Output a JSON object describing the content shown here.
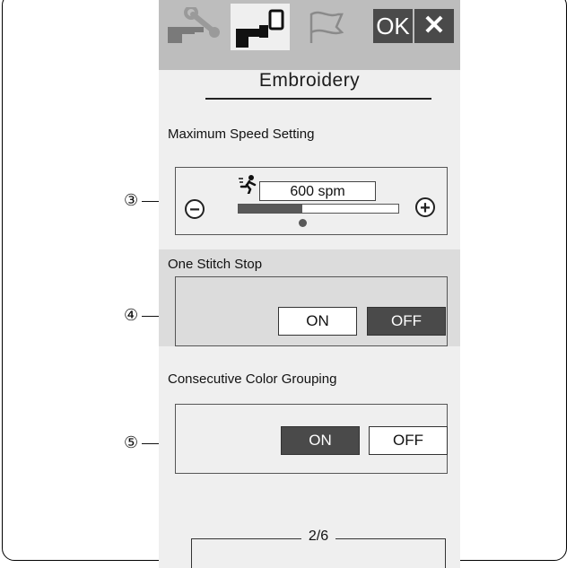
{
  "header": {
    "tabs": [
      {
        "name": "settings-tab",
        "icon": "wrench-machine-icon"
      },
      {
        "name": "embroidery-tab",
        "icon": "embroidery-machine-icon"
      },
      {
        "name": "language-tab",
        "icon": "flag-icon"
      }
    ],
    "ok_label": "OK",
    "close_label": "✕"
  },
  "page_title": "Embroidery",
  "max_speed": {
    "label": "Maximum Speed Setting",
    "value_text": "600 spm",
    "minus_label": "−",
    "plus_label": "+",
    "level_fraction": 0.4
  },
  "one_stitch_stop": {
    "label": "One Stitch Stop",
    "on_label": "ON",
    "off_label": "OFF",
    "selected": "OFF"
  },
  "color_grouping": {
    "label": "Consecutive Color Grouping",
    "on_label": "ON",
    "off_label": "OFF",
    "selected": "ON"
  },
  "callouts": [
    "③",
    "④",
    "⑤"
  ],
  "pager": {
    "page_text": "2/6"
  },
  "colors": {
    "selected_button": "#4a4a4a",
    "tab_bar": "#bdbdbd",
    "panel_bg": "#efefef",
    "highlight_section": "#dcdcdc"
  }
}
